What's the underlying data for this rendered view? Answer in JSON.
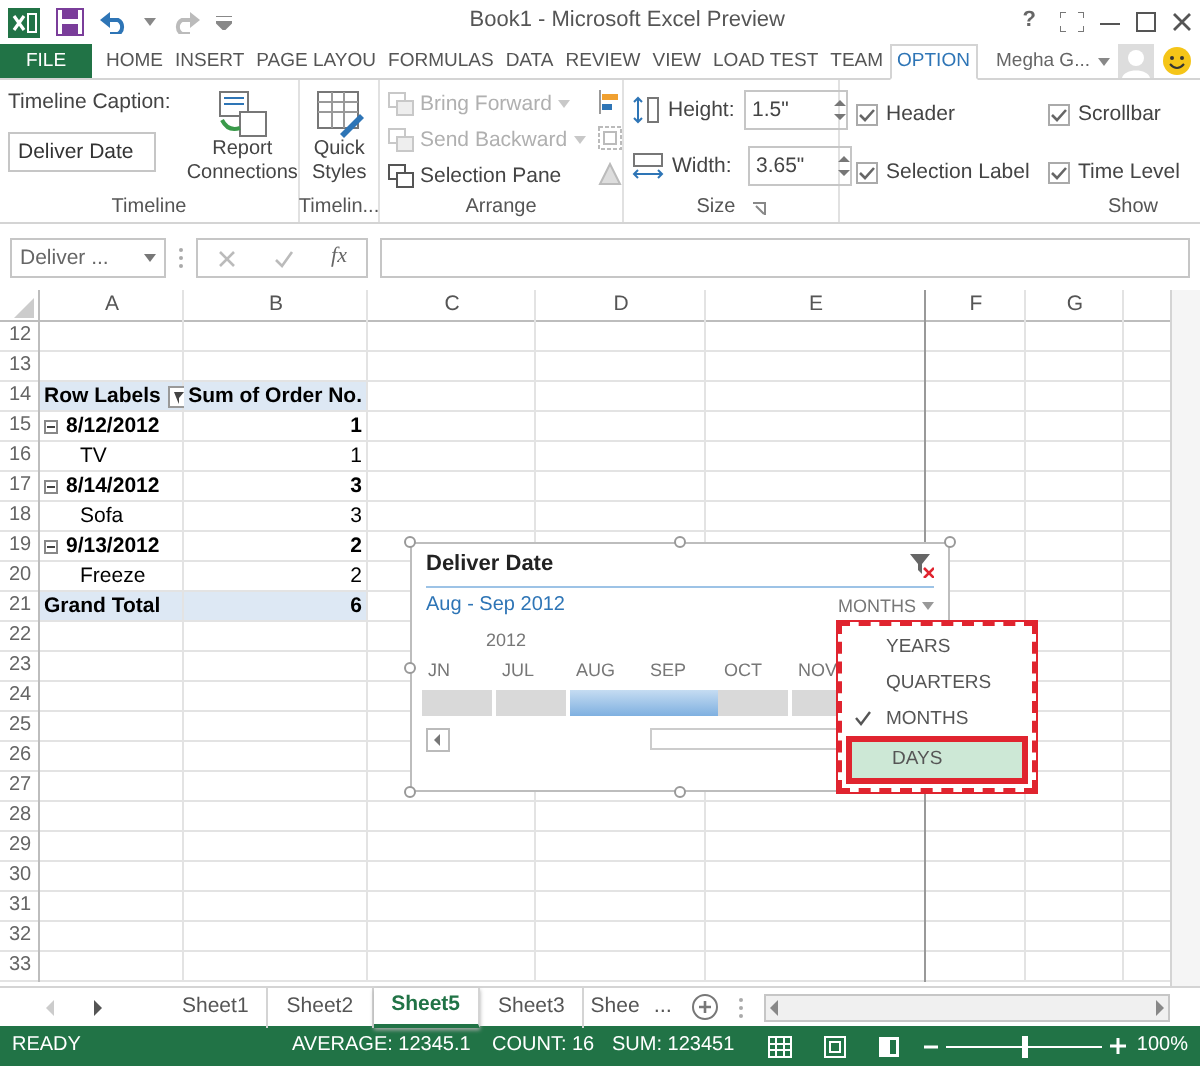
{
  "title_bar": {
    "title": "Book1 - Microsoft Excel Preview",
    "help": "?"
  },
  "ribbon_tabs": [
    {
      "label": "FILE",
      "kind": "file",
      "selected": false
    },
    {
      "label": "HOME",
      "kind": "tab",
      "selected": false
    },
    {
      "label": "INSERT",
      "kind": "tab",
      "selected": false
    },
    {
      "label": "PAGE LAYOU",
      "kind": "tab",
      "selected": false
    },
    {
      "label": "FORMULAS",
      "kind": "tab",
      "selected": false
    },
    {
      "label": "DATA",
      "kind": "tab",
      "selected": false
    },
    {
      "label": "REVIEW",
      "kind": "tab",
      "selected": false
    },
    {
      "label": "VIEW",
      "kind": "tab",
      "selected": false
    },
    {
      "label": "LOAD TEST",
      "kind": "tab",
      "selected": false
    },
    {
      "label": "TEAM",
      "kind": "tab",
      "selected": false
    },
    {
      "label": "OPTION",
      "kind": "tab",
      "selected": true
    }
  ],
  "user": "Megha G...",
  "ribbon": {
    "timeline": {
      "caption_label": "Timeline Caption:",
      "caption_value": "Deliver Date",
      "connections": "Report Connections",
      "group_label": "Timeline"
    },
    "styles": {
      "button": "Quick Styles",
      "group_label": "Timelin..."
    },
    "arrange": {
      "items": [
        {
          "label": "Bring Forward",
          "disabled": true
        },
        {
          "label": "Send Backward",
          "disabled": true
        },
        {
          "label": "Selection Pane",
          "disabled": false
        }
      ],
      "group_label": "Arrange"
    },
    "size": {
      "height_label": "Height:",
      "height": "1.5\"",
      "width_label": "Width:",
      "width": "3.65\"",
      "group_label": "Size"
    },
    "show": {
      "options": [
        {
          "label": "Header",
          "checked": true
        },
        {
          "label": "Scrollbar",
          "checked": true
        },
        {
          "label": "Selection Label",
          "checked": true
        },
        {
          "label": "Time Level",
          "checked": true
        }
      ],
      "group_label": "Show"
    }
  },
  "formula_bar": {
    "name_box": "Deliver ...",
    "function_label": "fx"
  },
  "columns": [
    "A",
    "B",
    "C",
    "D",
    "E",
    "F",
    "G"
  ],
  "rows": [
    {
      "number": "12"
    },
    {
      "number": "13"
    },
    {
      "number": "14",
      "kind": "header",
      "label": "Row Labels",
      "value": "Sum of Order No."
    },
    {
      "number": "15",
      "kind": "group",
      "label": "8/12/2012",
      "value": "1",
      "expanded": true
    },
    {
      "number": "16",
      "kind": "item",
      "label": "TV",
      "value": "1"
    },
    {
      "number": "17",
      "kind": "group",
      "label": "8/14/2012",
      "value": "3",
      "expanded": true
    },
    {
      "number": "18",
      "kind": "item",
      "label": "Sofa",
      "value": "3"
    },
    {
      "number": "19",
      "kind": "group",
      "label": "9/13/2012",
      "value": "2",
      "expanded": true
    },
    {
      "number": "20",
      "kind": "item",
      "label": "Freeze",
      "value": "2"
    },
    {
      "number": "21",
      "kind": "total",
      "label": "Grand Total",
      "value": "6"
    },
    {
      "number": "22"
    },
    {
      "number": "23"
    },
    {
      "number": "24"
    },
    {
      "number": "25"
    },
    {
      "number": "26"
    },
    {
      "number": "27"
    },
    {
      "number": "28"
    },
    {
      "number": "29"
    },
    {
      "number": "30"
    },
    {
      "number": "31"
    },
    {
      "number": "32"
    },
    {
      "number": "33"
    }
  ],
  "timeline": {
    "title": "Deliver Date",
    "range": "Aug - Sep 2012",
    "level": "MONTHS",
    "year": "2012",
    "months": [
      {
        "label": "JN",
        "selected": false
      },
      {
        "label": "JUL",
        "selected": false
      },
      {
        "label": "AUG",
        "selected": true
      },
      {
        "label": "SEP",
        "selected": true
      },
      {
        "label": "OCT",
        "selected": false
      },
      {
        "label": "NOV",
        "selected": false
      }
    ]
  },
  "level_menu": [
    {
      "label": "YEARS",
      "checked": false,
      "selected": false
    },
    {
      "label": "QUARTERS",
      "checked": false,
      "selected": false
    },
    {
      "label": "MONTHS",
      "checked": true,
      "selected": false
    },
    {
      "label": "DAYS",
      "checked": false,
      "selected": true
    }
  ],
  "sheet_tabs": [
    {
      "label": "Sheet1",
      "selected": false
    },
    {
      "label": "Sheet2",
      "selected": false
    },
    {
      "label": "Sheet5",
      "selected": true
    },
    {
      "label": "Sheet3",
      "selected": false
    },
    {
      "label": "Shee",
      "selected": false
    }
  ],
  "more_sheets": "...",
  "status_bar": {
    "state": "READY",
    "average": "AVERAGE: 12345.1",
    "count": "COUNT: 16",
    "sum": "SUM: 123451",
    "zoom": "100%",
    "level": 0.5
  }
}
